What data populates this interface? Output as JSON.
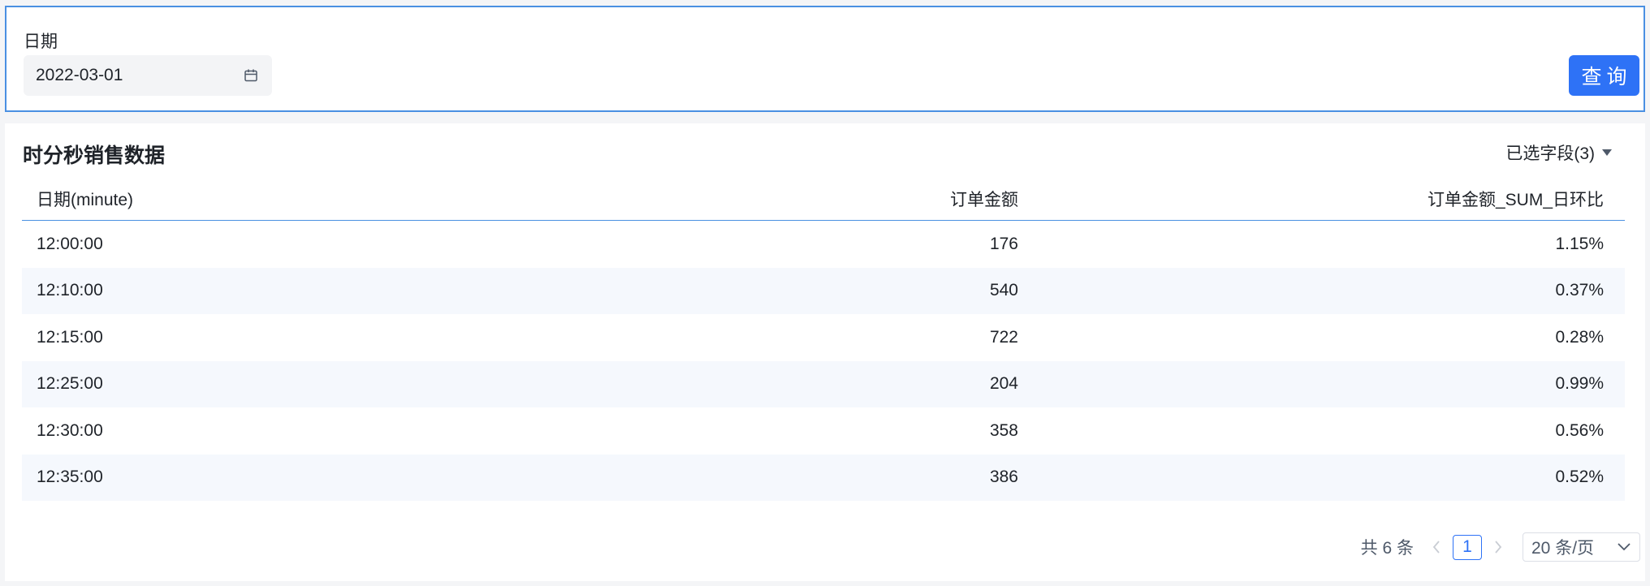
{
  "filter": {
    "date_label": "日期",
    "date_value": "2022-03-01",
    "query_button": "查询"
  },
  "table": {
    "title": "时分秒销售数据",
    "field_selector": "已选字段(3)",
    "columns": [
      "日期(minute)",
      "订单金额",
      "订单金额_SUM_日环比"
    ],
    "rows": [
      [
        "12:00:00",
        "176",
        "1.15%"
      ],
      [
        "12:10:00",
        "540",
        "0.37%"
      ],
      [
        "12:15:00",
        "722",
        "0.28%"
      ],
      [
        "12:25:00",
        "204",
        "0.99%"
      ],
      [
        "12:30:00",
        "358",
        "0.56%"
      ],
      [
        "12:35:00",
        "386",
        "0.52%"
      ]
    ]
  },
  "pagination": {
    "total": "共 6 条",
    "current_page": "1",
    "page_size": "20 条/页"
  },
  "icons": {
    "calendar": "calendar-icon",
    "caret": "caret-down-icon",
    "prev": "chevron-left-icon",
    "next": "chevron-right-icon",
    "dropdown": "chevron-down-icon"
  },
  "colors": {
    "accent": "#2e72f6",
    "border": "#4a90e2",
    "row_alt": "#f5f8fd"
  }
}
